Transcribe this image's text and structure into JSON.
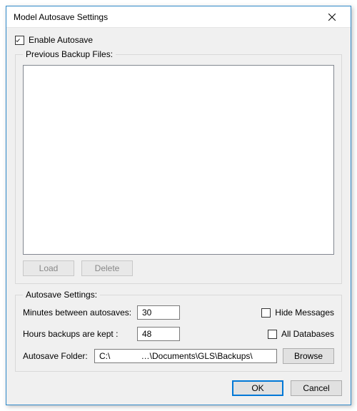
{
  "window": {
    "title": "Model Autosave Settings"
  },
  "enable": {
    "label": "Enable Autosave",
    "checked": true
  },
  "backup": {
    "legend": "Previous Backup Files:",
    "load_label": "Load",
    "delete_label": "Delete"
  },
  "settings": {
    "legend": "Autosave Settings:",
    "minutes_label": "Minutes between autosaves:",
    "minutes_value": "30",
    "hours_label": "Hours backups are kept :",
    "hours_value": "48",
    "hide_messages_label": "Hide Messages",
    "hide_messages_checked": false,
    "all_db_label": "All Databases",
    "all_db_checked": false,
    "folder_label": "Autosave Folder:",
    "folder_value": "C:\\             …\\Documents\\GLS\\Backups\\",
    "browse_label": "Browse"
  },
  "buttons": {
    "ok": "OK",
    "cancel": "Cancel"
  }
}
